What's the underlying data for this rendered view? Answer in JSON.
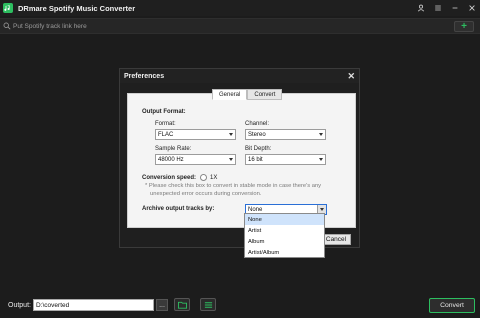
{
  "app": {
    "title": "DRmare Spotify Music Converter"
  },
  "search": {
    "placeholder": "Put Spotify track link here"
  },
  "dialog": {
    "title": "Preferences",
    "tabs": [
      "General",
      "Convert"
    ],
    "active_tab": "Convert",
    "output_format_heading": "Output Format:",
    "format_label": "Format:",
    "format_value": "FLAC",
    "channel_label": "Channel:",
    "channel_value": "Stereo",
    "sample_rate_label": "Sample Rate:",
    "sample_rate_value": "48000 Hz",
    "bit_depth_label": "Bit Depth:",
    "bit_depth_value": "16 bit",
    "conversion_speed_label": "Conversion speed:",
    "conversion_speed_value": "1X",
    "note_line1": "* Please check this box to convert in stable mode in case there's any",
    "note_line2": "unexpected error occurs during conversion.",
    "archive_label": "Archive output tracks by:",
    "archive_value": "None",
    "archive_options": [
      "None",
      "Artist",
      "Album",
      "Artist/Album"
    ],
    "cancel_label": "Cancel"
  },
  "bottom": {
    "output_label": "Output:",
    "output_path": "D:\\coverted",
    "more_label": "...",
    "convert_label": "Convert"
  },
  "colors": {
    "accent": "#2dbe60",
    "background": "#1c1c1c",
    "highlight": "#cfe3fb"
  }
}
